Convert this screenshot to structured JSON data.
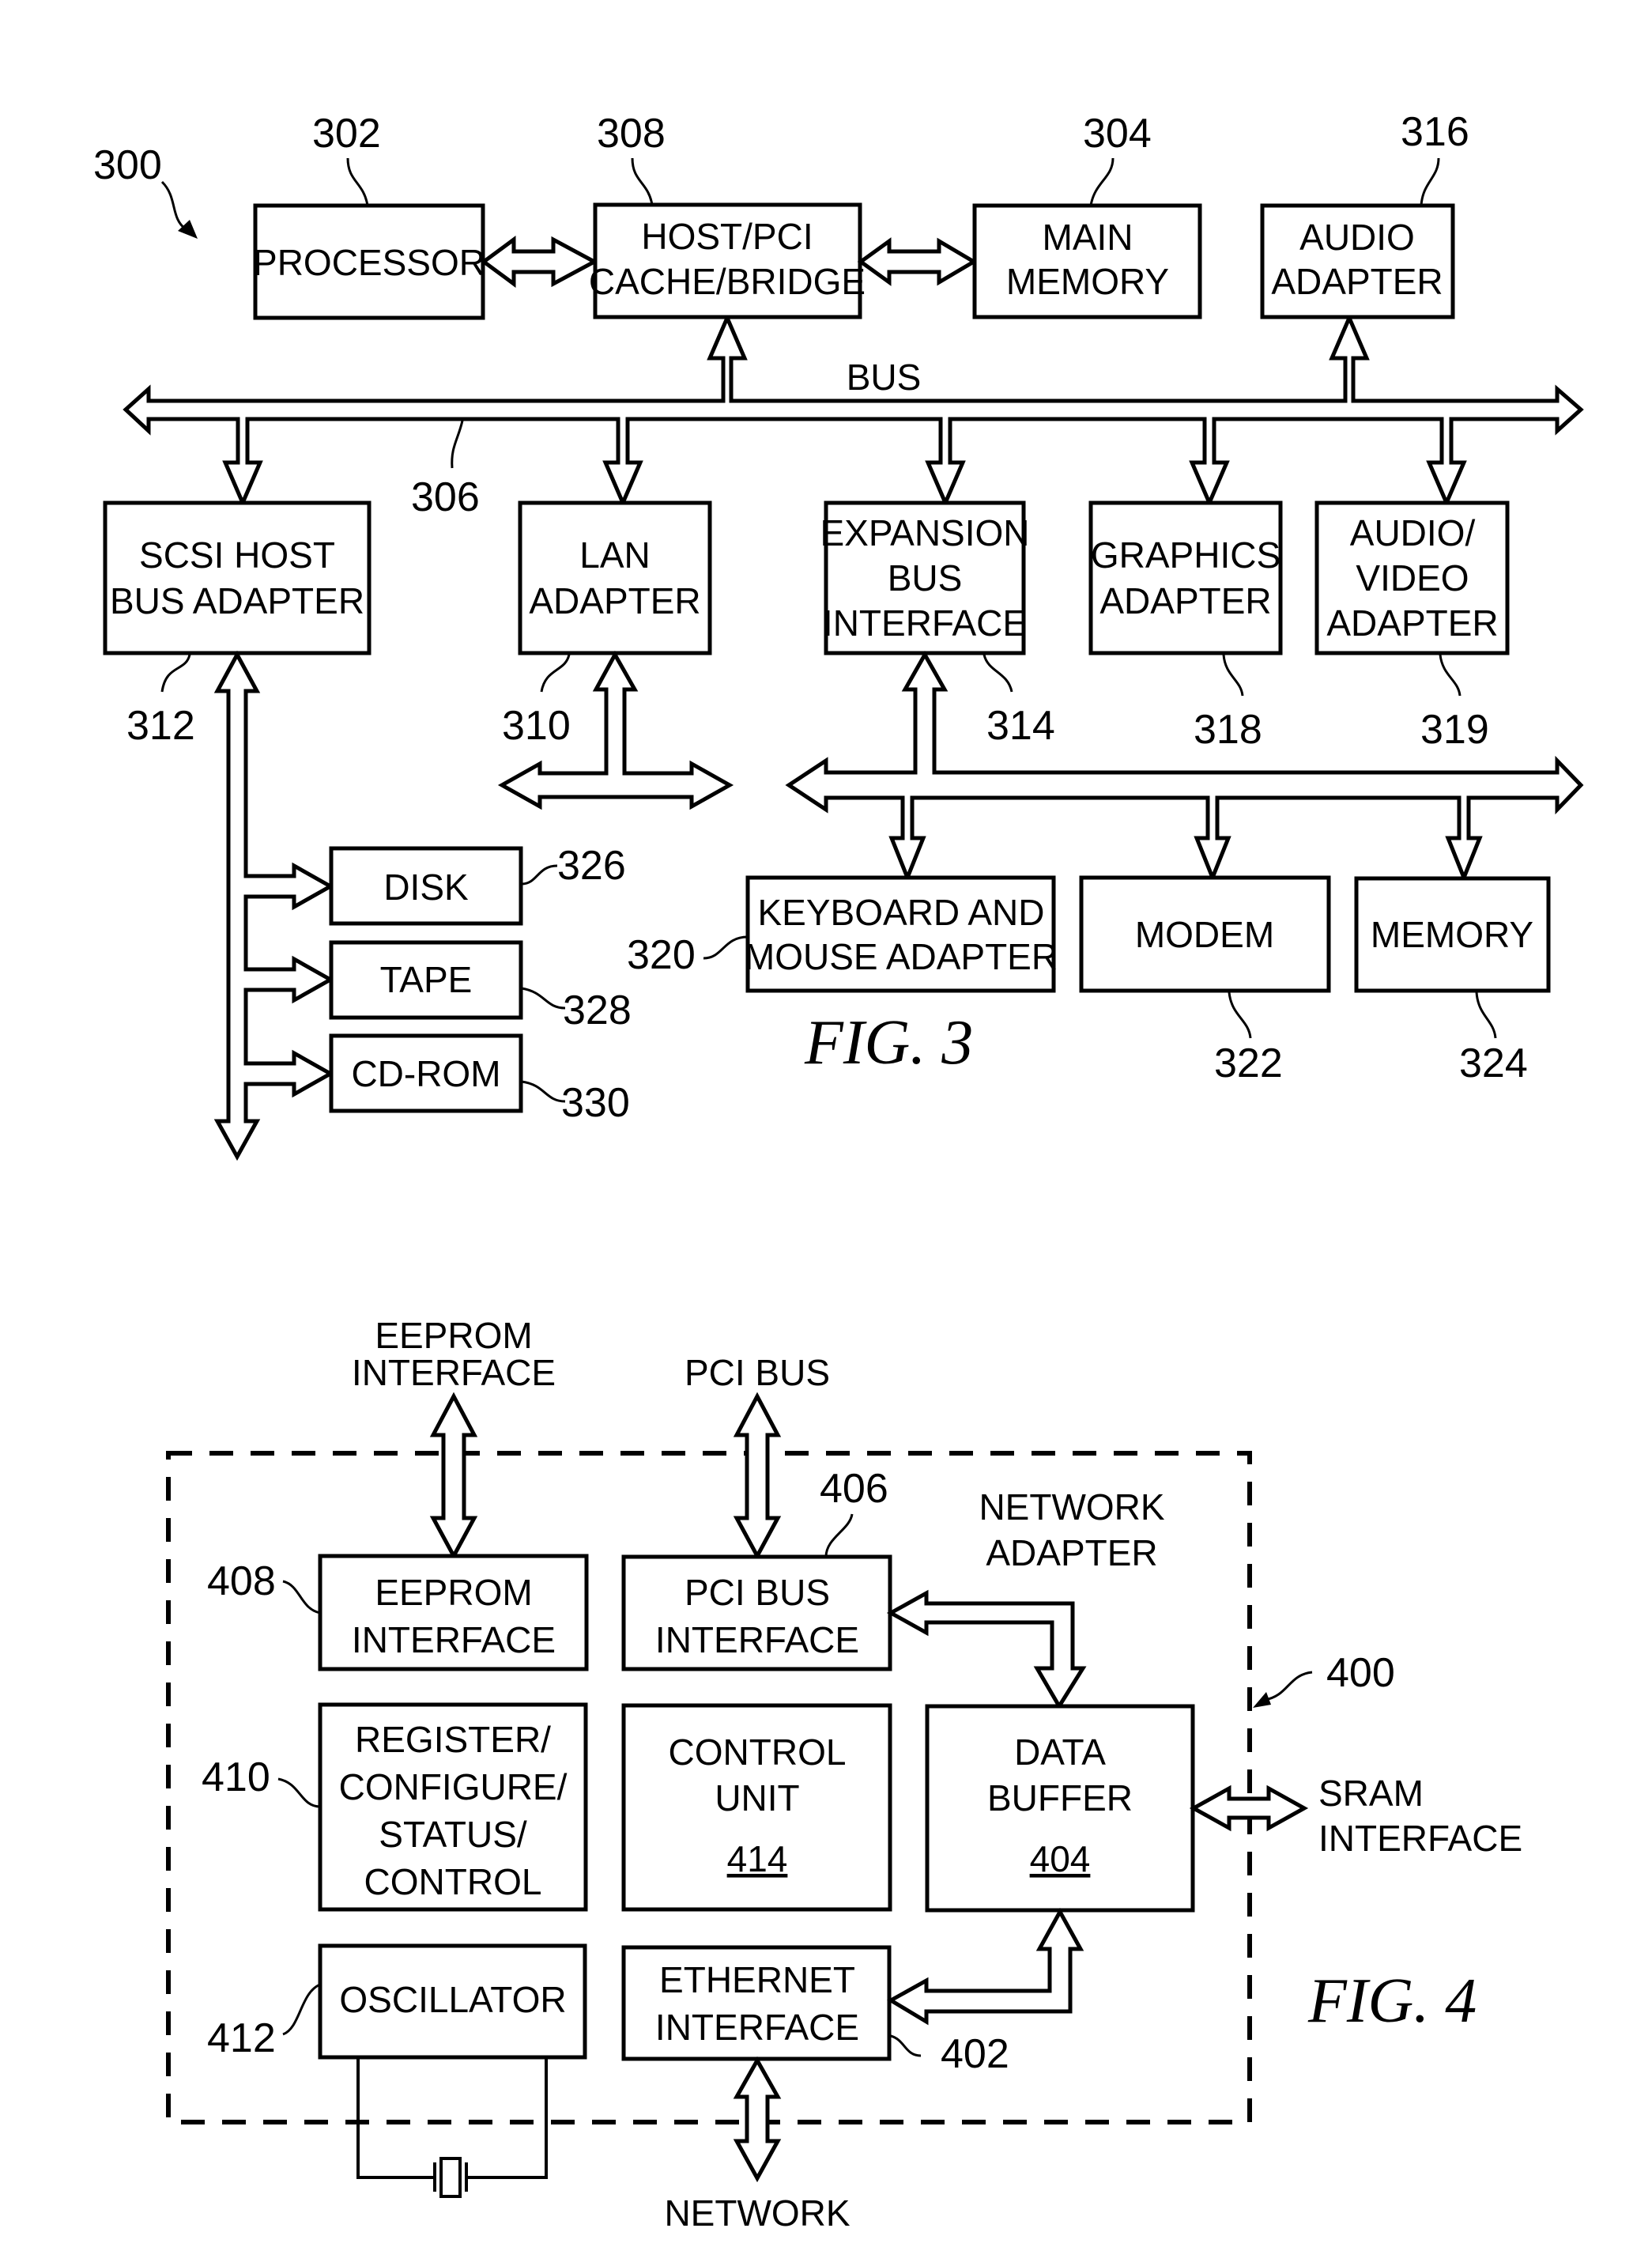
{
  "fig3": {
    "ref": "300",
    "caption": "FIG. 3",
    "bus_label": "BUS",
    "bus_ref": "306",
    "blocks": {
      "processor": {
        "ref": "302",
        "lines": [
          "PROCESSOR"
        ]
      },
      "host_bridge": {
        "ref": "308",
        "lines": [
          "HOST/PCI",
          "CACHE/BRIDGE"
        ]
      },
      "main_memory": {
        "ref": "304",
        "lines": [
          "MAIN",
          "MEMORY"
        ]
      },
      "audio_adapter": {
        "ref": "316",
        "lines": [
          "AUDIO",
          "ADAPTER"
        ]
      },
      "scsi": {
        "ref": "312",
        "lines": [
          "SCSI HOST",
          "BUS ADAPTER"
        ]
      },
      "lan": {
        "ref": "310",
        "lines": [
          "LAN",
          "ADAPTER"
        ]
      },
      "expansion": {
        "ref": "314",
        "lines": [
          "EXPANSION",
          "BUS",
          "INTERFACE"
        ]
      },
      "graphics": {
        "ref": "318",
        "lines": [
          "GRAPHICS",
          "ADAPTER"
        ]
      },
      "av": {
        "ref": "319",
        "lines": [
          "AUDIO/",
          "VIDEO",
          "ADAPTER"
        ]
      },
      "disk": {
        "ref": "326",
        "lines": [
          "DISK"
        ]
      },
      "tape": {
        "ref": "328",
        "lines": [
          "TAPE"
        ]
      },
      "cdrom": {
        "ref": "330",
        "lines": [
          "CD-ROM"
        ]
      },
      "kbd": {
        "ref": "320",
        "lines": [
          "KEYBOARD AND",
          "MOUSE ADAPTER"
        ]
      },
      "modem": {
        "ref": "322",
        "lines": [
          "MODEM"
        ]
      },
      "memory": {
        "ref": "324",
        "lines": [
          "MEMORY"
        ]
      }
    }
  },
  "fig4": {
    "ref": "400",
    "caption": "FIG. 4",
    "title_lines": [
      "NETWORK",
      "ADAPTER"
    ],
    "ext": {
      "eeprom_if": [
        "EEPROM",
        "INTERFACE"
      ],
      "pci_bus": [
        "PCI BUS"
      ],
      "sram_if": [
        "SRAM",
        "INTERFACE"
      ],
      "network": [
        "NETWORK"
      ]
    },
    "blocks": {
      "eeprom": {
        "ref": "408",
        "lines": [
          "EEPROM",
          "INTERFACE"
        ]
      },
      "pci": {
        "ref": "406",
        "lines": [
          "PCI BUS",
          "INTERFACE"
        ]
      },
      "register": {
        "ref": "410",
        "lines": [
          "REGISTER/",
          "CONFIGURE/",
          "STATUS/",
          "CONTROL"
        ]
      },
      "control": {
        "ref": "414",
        "lines": [
          "CONTROL",
          "UNIT"
        ]
      },
      "databuf": {
        "ref": "404",
        "lines": [
          "DATA",
          "BUFFER"
        ]
      },
      "osc": {
        "ref": "412",
        "lines": [
          "OSCILLATOR"
        ]
      },
      "eth": {
        "ref": "402",
        "lines": [
          "ETHERNET",
          "INTERFACE"
        ]
      }
    }
  }
}
